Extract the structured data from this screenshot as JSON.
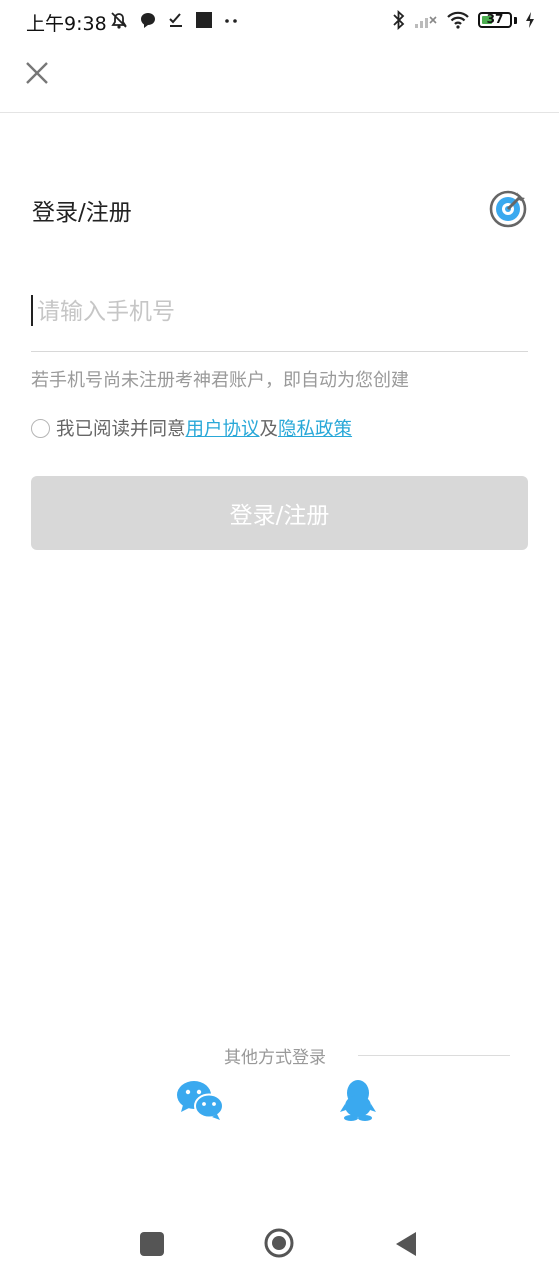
{
  "status_bar": {
    "time": "上午9:38",
    "battery_level": "37",
    "battery_color": "#4caf50"
  },
  "header": {
    "close_icon": "close-icon",
    "title": "登录/注册",
    "logo_icon": "target-logo-icon"
  },
  "form": {
    "phone_placeholder": "请输入手机号",
    "phone_value": "",
    "hint": "若手机号尚未注册考神君账户，即自动为您创建",
    "agreement": {
      "prefix": "我已阅读并同意",
      "user_agreement": "用户协议",
      "conjunction": "及",
      "privacy_policy": "隐私政策",
      "checked": false
    },
    "submit_label": "登录/注册"
  },
  "other_login": {
    "label": "其他方式登录",
    "methods": [
      "wechat-icon",
      "qq-icon"
    ]
  },
  "colors": {
    "link": "#29a8d8",
    "button_disabled": "#d8d8d8",
    "icon_blue": "#3aa9ef"
  }
}
